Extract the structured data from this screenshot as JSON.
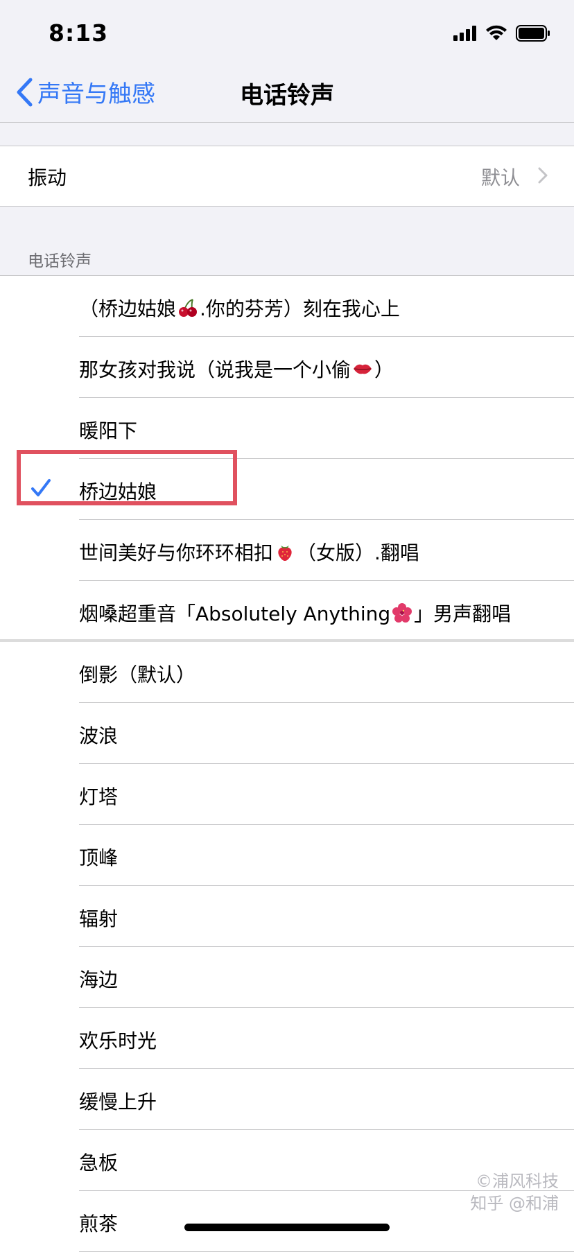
{
  "status_bar": {
    "time": "8:13"
  },
  "nav": {
    "back_label": "声音与触感",
    "title": "电话铃声"
  },
  "vibration": {
    "label": "振动",
    "value": "默认"
  },
  "section_header": "电话铃声",
  "custom_ringtones": [
    {
      "before": "（桥边姑娘",
      "emoji": "cherry",
      "after": ".你的芬芳）刻在我心上"
    },
    {
      "before": "那女孩对我说（说我是一个小偷",
      "emoji": "lips",
      "after": "）"
    },
    {
      "before": "暖阳下",
      "emoji": "",
      "after": ""
    },
    {
      "before": "桥边姑娘",
      "emoji": "",
      "after": "",
      "selected": true
    },
    {
      "before": "世间美好与你环环相扣",
      "emoji": "strawberry",
      "after": "（女版）.翻唱"
    },
    {
      "before": "烟嗓超重音「Absolutely Anything",
      "emoji": "hibiscus",
      "after": "」男声翻唱"
    }
  ],
  "default_ringtones": [
    "倒影（默认）",
    "波浪",
    "灯塔",
    "顶峰",
    "辐射",
    "海边",
    "欢乐时光",
    "缓慢上升",
    "急板",
    "煎茶"
  ],
  "watermark": {
    "line1": "©浦风科技",
    "line2": "知乎 @和浦"
  },
  "colors": {
    "accent": "#3478f6",
    "highlight": "#e0515f",
    "background": "#f2f2f7"
  }
}
